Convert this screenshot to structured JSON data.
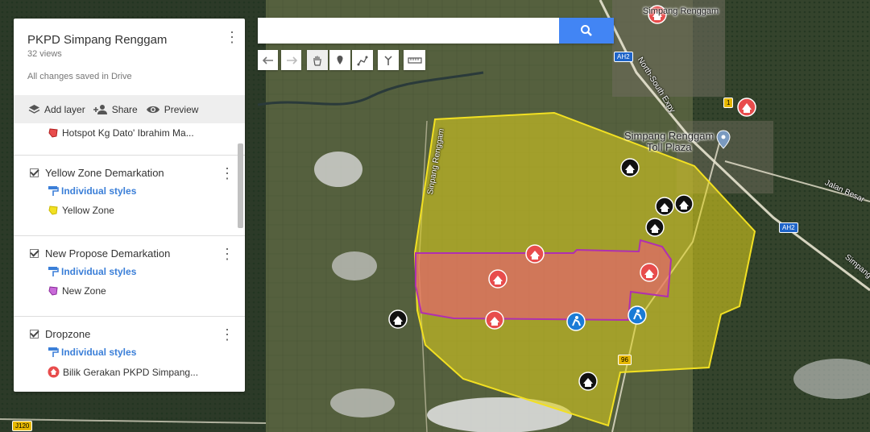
{
  "map": {
    "title": "PKPD Simpang Renggam",
    "views": "32 views",
    "save_status": "All changes saved in Drive",
    "actions": {
      "add_layer": "Add layer",
      "share": "Share",
      "preview": "Preview"
    }
  },
  "layers": {
    "top_feature": "Hotspot Kg Dato' Ibrahim Ma...",
    "items": [
      {
        "name": "Yellow Zone Demarkation",
        "styles": "Individual styles",
        "feature": "Yellow Zone"
      },
      {
        "name": "New Propose Demarkation",
        "styles": "Individual styles",
        "feature": "New Zone"
      },
      {
        "name": "Dropzone",
        "styles": "Individual styles",
        "feature": "Bilik Gerakan PKPD Simpang..."
      }
    ]
  },
  "search": {
    "placeholder": "",
    "value": ""
  },
  "labels": {
    "place": "Simpang Renggam",
    "place2": "Toll Plaza",
    "town": "Simpang Renggam",
    "road_ns": "North-South Expy",
    "road_jb": "Jalan Besar",
    "road_sp": "Simpang Renggam",
    "road_sp_short": "Sinpang Renggam",
    "ah2_a": "AH2",
    "ah2_b": "AH2",
    "r1": "1",
    "r96": "96",
    "j120": "J120"
  },
  "colors": {
    "yellow_zone": "#e8d42a",
    "pink_zone": "#f0607a",
    "purple_border": "#b02fb0",
    "marker_red": "#e84c4c",
    "marker_black": "#111111",
    "marker_blue": "#1a7bd6",
    "search_blue": "#4285f4"
  },
  "icons": [
    "undo-icon",
    "redo-icon",
    "hand-icon",
    "marker-icon",
    "draw-line-icon",
    "route-icon",
    "ruler-icon",
    "search-icon",
    "layers-icon",
    "share-icon",
    "eye-icon"
  ]
}
